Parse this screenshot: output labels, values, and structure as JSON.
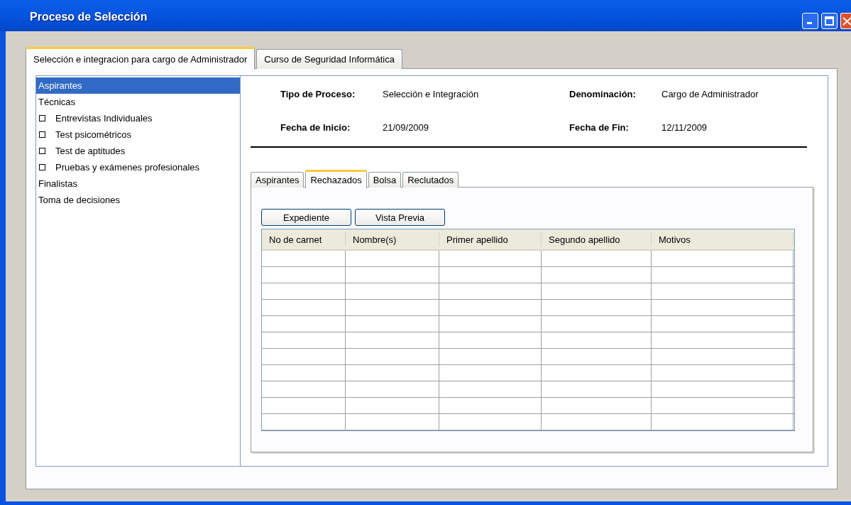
{
  "window": {
    "title": "Proceso de Selección"
  },
  "tabs": [
    {
      "label": "Selección e integracion para cargo de Administrador",
      "selected": true
    },
    {
      "label": "Curso de Seguridad Informática",
      "selected": false
    }
  ],
  "sidebar": {
    "items": [
      {
        "label": "Aspirantes",
        "kind": "item",
        "selected": true
      },
      {
        "label": "Técnicas",
        "kind": "item",
        "selected": false,
        "children": [
          {
            "label": "Entrevistas Individuales",
            "kind": "checkbox",
            "checked": false,
            "selected": false
          },
          {
            "label": "Test psicométricos",
            "kind": "checkbox",
            "checked": false,
            "selected": false
          },
          {
            "label": "Test de aptitudes",
            "kind": "checkbox",
            "checked": false,
            "selected": false
          },
          {
            "label": "Pruebas y exámenes profesionales",
            "kind": "checkbox",
            "checked": false,
            "selected": false
          }
        ]
      },
      {
        "label": "Finalistas",
        "kind": "item",
        "selected": false
      },
      {
        "label": "Toma de decisiones",
        "kind": "item",
        "selected": false
      }
    ]
  },
  "fields": [
    {
      "label": "Tipo de Proceso:",
      "value": "Selección e Integración"
    },
    {
      "label": "Denominación:",
      "value": "Cargo de Administrador"
    },
    {
      "label": "Fecha de Inicio:",
      "value": "21/09/2009"
    },
    {
      "label": "Fecha de Fin:",
      "value": "12/11/2009"
    }
  ],
  "inner_tabs": [
    {
      "label": "Aspirantes",
      "selected": false
    },
    {
      "label": "Rechazados",
      "selected": true
    },
    {
      "label": "Bolsa",
      "selected": false
    },
    {
      "label": "Reclutados",
      "selected": false
    }
  ],
  "buttons": [
    "Expediente",
    "Vista Previa"
  ],
  "table": {
    "columns": [
      "No de carnet",
      "Nombre(s)",
      "Primer apellido",
      "Segundo apellido",
      "Motivos"
    ]
  }
}
